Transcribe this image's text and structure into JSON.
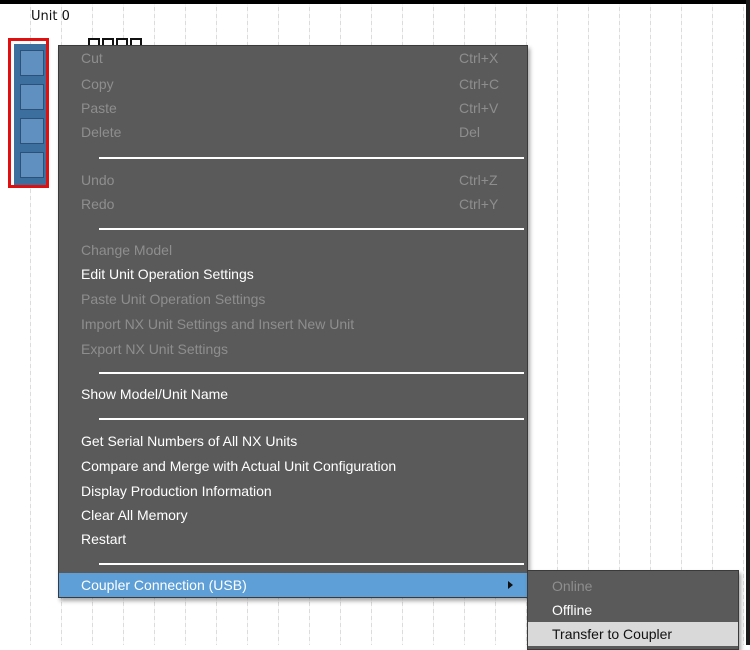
{
  "canvas": {
    "unit_title": "Unit 0"
  },
  "context_menu": {
    "items": [
      {
        "label": "Cut",
        "shortcut": "Ctrl+X"
      },
      {
        "label": "Copy",
        "shortcut": "Ctrl+C"
      },
      {
        "label": "Paste",
        "shortcut": "Ctrl+V"
      },
      {
        "label": "Delete",
        "shortcut": "Del"
      },
      {
        "label": "Undo",
        "shortcut": "Ctrl+Z"
      },
      {
        "label": "Redo",
        "shortcut": "Ctrl+Y"
      },
      {
        "label": "Change Model"
      },
      {
        "label": "Edit Unit Operation Settings"
      },
      {
        "label": "Paste Unit Operation Settings"
      },
      {
        "label": "Import NX Unit Settings and Insert New Unit"
      },
      {
        "label": "Export NX Unit Settings"
      },
      {
        "label": "Show Model/Unit Name"
      },
      {
        "label": "Get Serial Numbers of All NX Units"
      },
      {
        "label": "Compare and Merge with Actual Unit Configuration"
      },
      {
        "label": "Display Production Information"
      },
      {
        "label": "Clear All Memory"
      },
      {
        "label": "Restart"
      },
      {
        "label": "Coupler Connection (USB)"
      }
    ]
  },
  "submenu": {
    "items": [
      {
        "label": "Online"
      },
      {
        "label": "Offline"
      },
      {
        "label": "Transfer to Coupler"
      }
    ]
  },
  "colors": {
    "menu_bg": "#5a5a5a",
    "hover_bg": "#5d9fd6",
    "disabled_text": "#8e8e8e",
    "highlight_border": "#e01010",
    "unit_blue": "#3d6f9e"
  }
}
